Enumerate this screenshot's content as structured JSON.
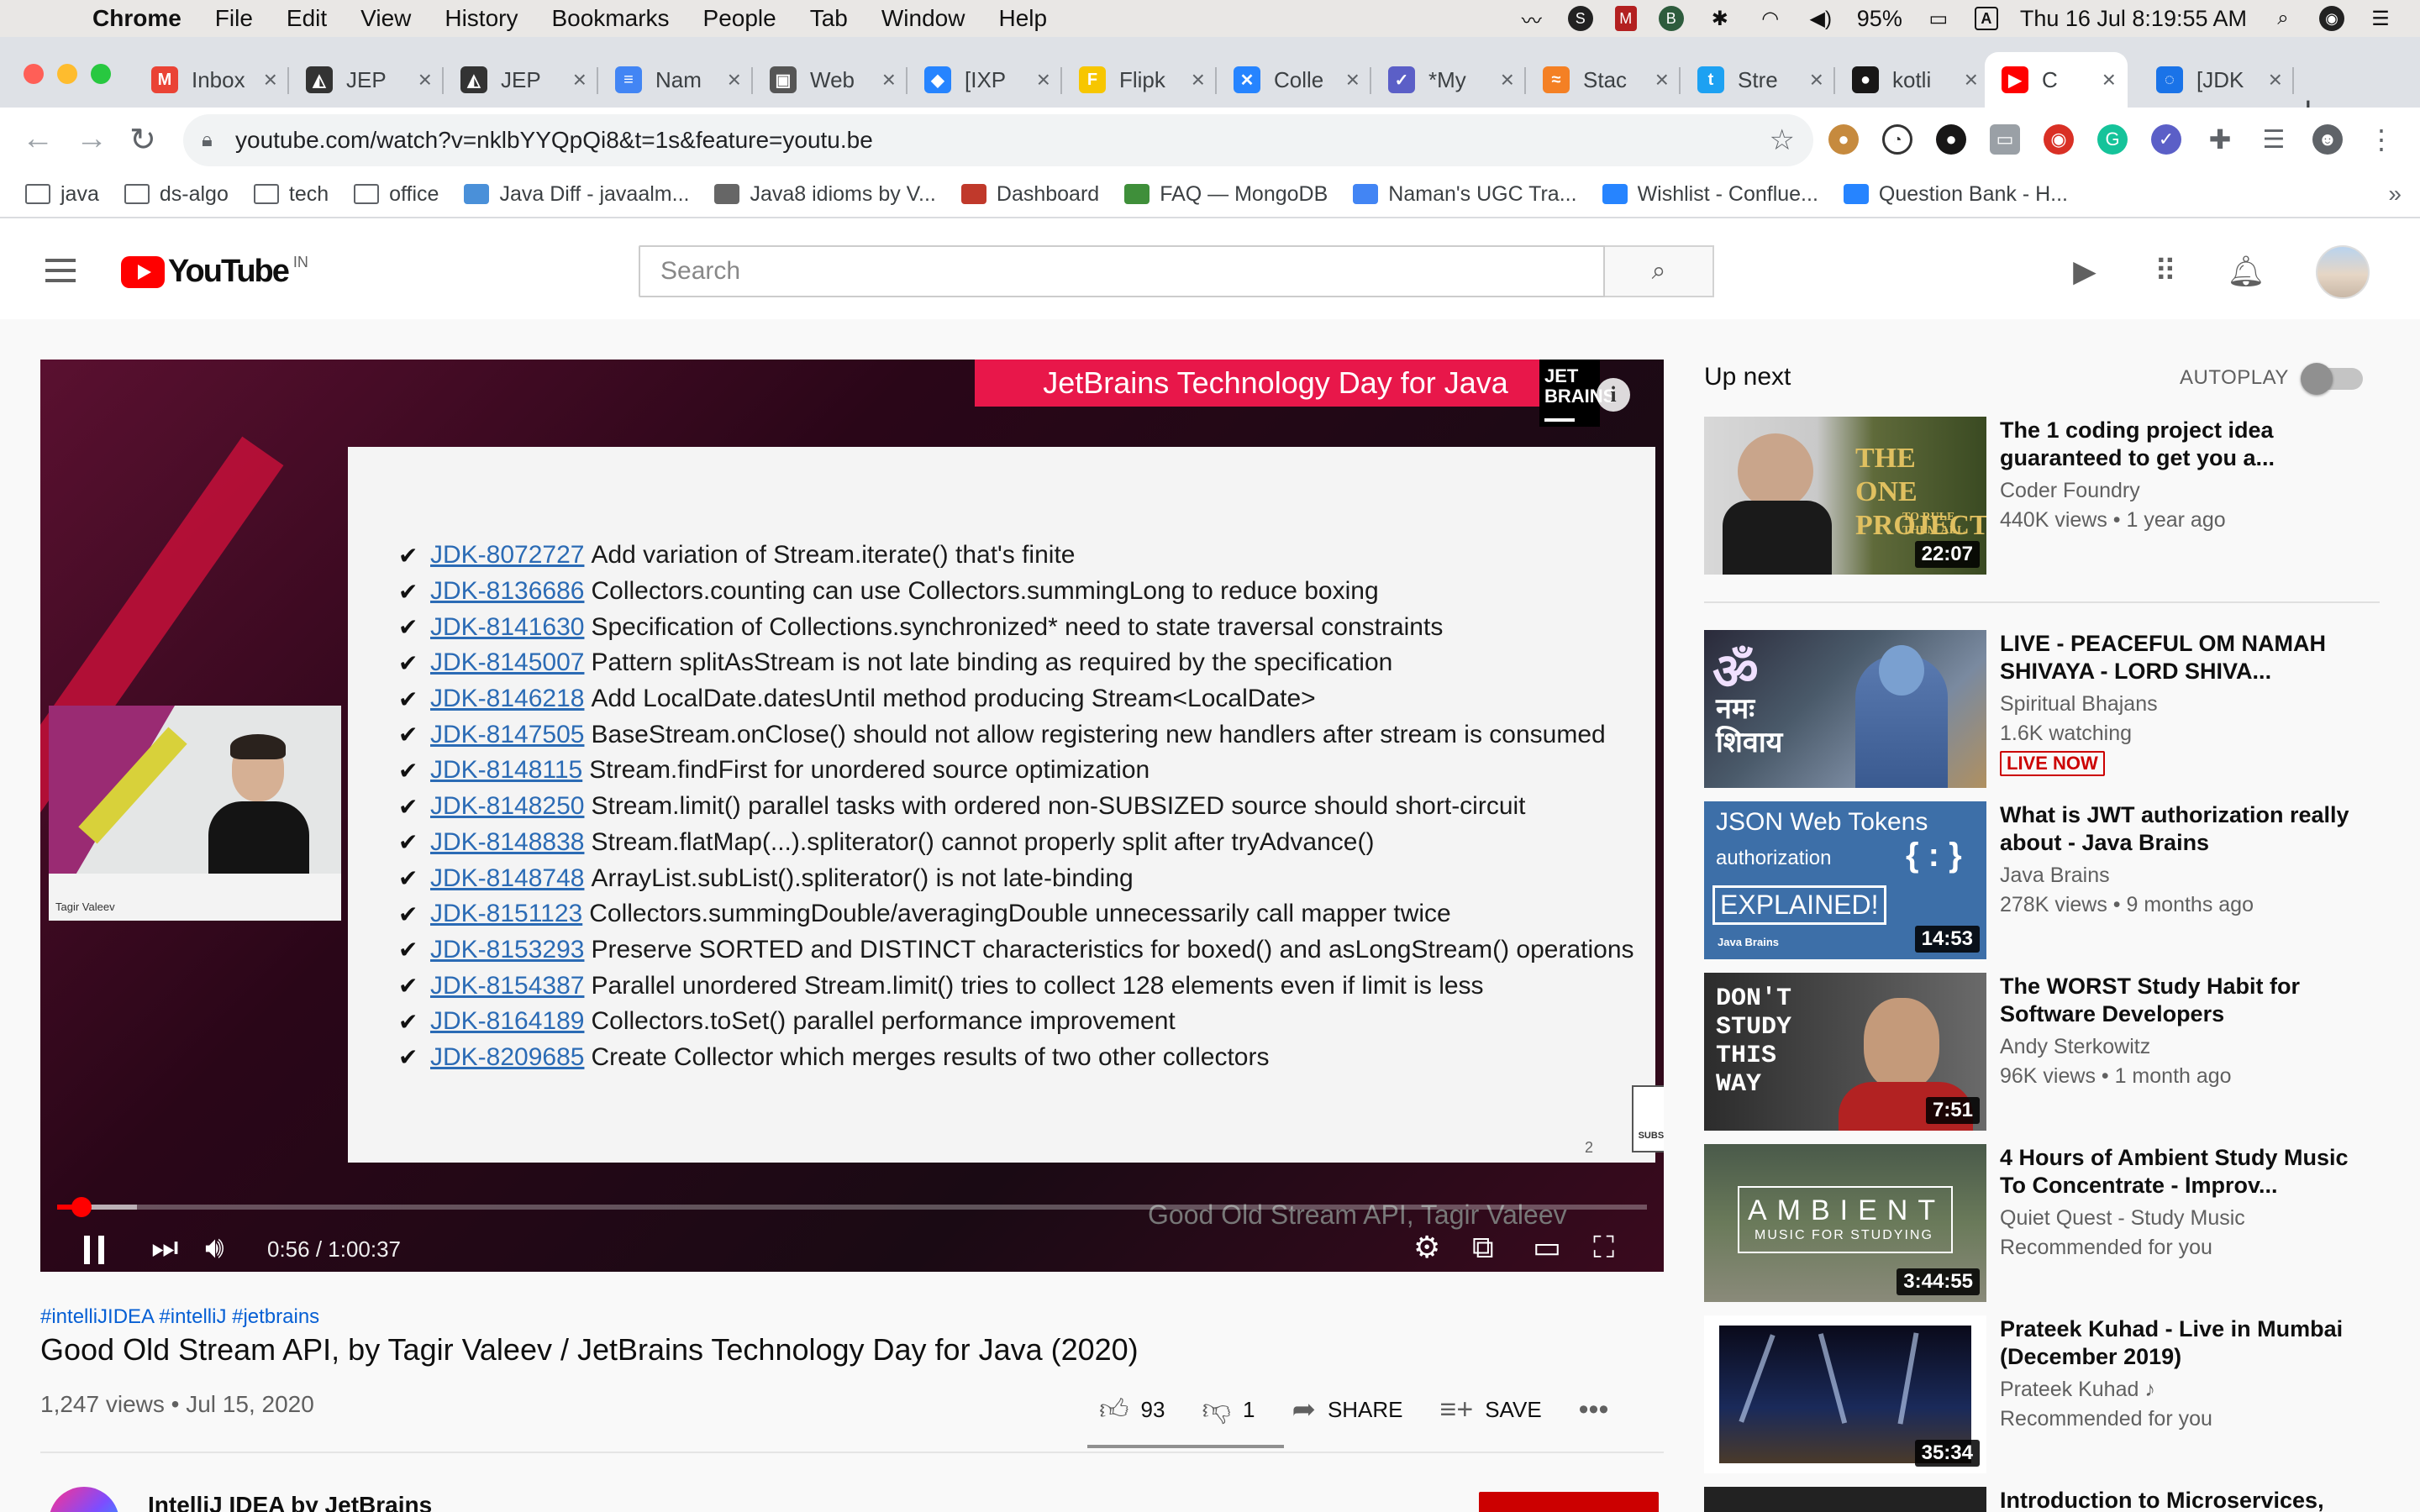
{
  "menubar": {
    "app": "Chrome",
    "items": [
      "File",
      "Edit",
      "View",
      "History",
      "Bookmarks",
      "People",
      "Tab",
      "Window",
      "Help"
    ],
    "battery": "95%",
    "datetime": "Thu 16 Jul  8:19:55 AM"
  },
  "tabs": [
    {
      "label": "Inbox",
      "icon": "gmail-icon",
      "color": "#ea4335",
      "glyph": "M"
    },
    {
      "label": "JEP",
      "icon": "jep-icon",
      "color": "#333333",
      "glyph": "◭"
    },
    {
      "label": "JEP",
      "icon": "jep-icon",
      "color": "#333333",
      "glyph": "◭"
    },
    {
      "label": "Nam",
      "icon": "docs-icon",
      "color": "#4285f4",
      "glyph": "≡"
    },
    {
      "label": "Web",
      "icon": "web-icon",
      "color": "#555555",
      "glyph": "▣"
    },
    {
      "label": "[IXP",
      "icon": "jira-icon",
      "color": "#2684ff",
      "glyph": "◆"
    },
    {
      "label": "Flipk",
      "icon": "flipkart-icon",
      "color": "#f7c600",
      "glyph": "F"
    },
    {
      "label": "Colle",
      "icon": "confluence-icon",
      "color": "#2684ff",
      "glyph": "✕"
    },
    {
      "label": "*My",
      "icon": "check-icon",
      "color": "#5b5fc7",
      "glyph": "✓"
    },
    {
      "label": "Stac",
      "icon": "stackoverflow-icon",
      "color": "#f48024",
      "glyph": "≈"
    },
    {
      "label": "Stre",
      "icon": "twitter-icon",
      "color": "#1da1f2",
      "glyph": "t"
    },
    {
      "label": "kotli",
      "icon": "github-icon",
      "color": "#181717",
      "glyph": "●"
    },
    {
      "label": "C",
      "icon": "youtube-icon",
      "color": "#ff0000",
      "glyph": "▶"
    },
    {
      "label": "[JDK",
      "icon": "loading-icon",
      "color": "#1a73e8",
      "glyph": "◌"
    }
  ],
  "toolbar": {
    "url": "youtube.com/watch?v=nklbYYQpQi8&t=1s&feature=youtu.be"
  },
  "bookmarks": [
    {
      "label": "java",
      "type": "folder"
    },
    {
      "label": "ds-algo",
      "type": "folder"
    },
    {
      "label": "tech",
      "type": "folder"
    },
    {
      "label": "office",
      "type": "folder"
    },
    {
      "label": "Java Diff - javaalm...",
      "type": "link",
      "color": "#4a90d9"
    },
    {
      "label": "Java8 idioms by V...",
      "type": "link",
      "color": "#666666"
    },
    {
      "label": "Dashboard",
      "type": "link",
      "color": "#c0392b"
    },
    {
      "label": "FAQ — MongoDB",
      "type": "link",
      "color": "#3f8f3a"
    },
    {
      "label": "Naman's UGC Tra...",
      "type": "link",
      "color": "#4285f4"
    },
    {
      "label": "Wishlist - Conflue...",
      "type": "link",
      "color": "#2684ff"
    },
    {
      "label": "Question Bank - H...",
      "type": "link",
      "color": "#2684ff"
    }
  ],
  "bookmarks_more": "»",
  "yt": {
    "logo_text": "YouTube",
    "region": "IN",
    "search_placeholder": "Search"
  },
  "player": {
    "banner": "JetBrains Technology Day for Java",
    "logo": "JET BRAINS",
    "slide_items": [
      {
        "id": "JDK-8072727",
        "text": "Add variation of Stream.iterate() that's finite"
      },
      {
        "id": "JDK-8136686",
        "text": "Collectors.counting can use Collectors.summingLong to reduce boxing"
      },
      {
        "id": "JDK-8141630",
        "text": "Specification of Collections.synchronized* need to state traversal constraints"
      },
      {
        "id": "JDK-8145007",
        "text": "Pattern splitAsStream is not late binding as required by the specification"
      },
      {
        "id": "JDK-8146218",
        "text": "Add LocalDate.datesUntil method producing Stream<LocalDate>"
      },
      {
        "id": "JDK-8147505",
        "text": "BaseStream.onClose() should not allow registering new handlers after stream is consumed"
      },
      {
        "id": "JDK-8148115",
        "text": "Stream.findFirst for unordered source optimization"
      },
      {
        "id": "JDK-8148250",
        "text": "Stream.limit() parallel tasks with ordered non-SUBSIZED source should short-circuit"
      },
      {
        "id": "JDK-8148838",
        "text": "Stream.flatMap(...).spliterator() cannot properly split after tryAdvance()"
      },
      {
        "id": "JDK-8148748",
        "text": "ArrayList.subList().spliterator() is not late-binding"
      },
      {
        "id": "JDK-8151123",
        "text": "Collectors.summingDouble/averagingDouble unnecessarily call mapper twice"
      },
      {
        "id": "JDK-8153293",
        "text": "Preserve SORTED and DISTINCT characteristics for boxed() and asLongStream() operations"
      },
      {
        "id": "JDK-8154387",
        "text": "Parallel unordered Stream.limit() tries to collect 128 elements even if limit is less"
      },
      {
        "id": "JDK-8164189",
        "text": "Collectors.toSet() parallel performance improvement"
      },
      {
        "id": "JDK-8209685",
        "text": "Create Collector which merges results of two other collectors"
      }
    ],
    "slide_number": "2",
    "subscribe": "SUBSCRIBE",
    "speaker_name": "Tagir Valeev",
    "subtitle_overlay": "Good Old Stream API, Tagir Valeev",
    "time": "0:56 / 1:00:37",
    "progress_fraction": 0.0154
  },
  "video": {
    "hashtags": "#intelliJIDEA #intelliJ #jetbrains",
    "title": "Good Old Stream API, by Tagir Valeev / JetBrains Technology Day for Java (2020)",
    "meta": "1,247 views • Jul 15, 2020",
    "likes": "93",
    "dislikes": "1",
    "share": "SHARE",
    "save": "SAVE",
    "channel": "IntelliJ IDEA by JetBrains"
  },
  "sidebar": {
    "up_next": "Up next",
    "autoplay": "AUTOPLAY",
    "cards": [
      {
        "title": "The 1 coding project idea guaranteed to get you a...",
        "channel": "Coder Foundry",
        "stats": "440K views • 1 year ago",
        "duration": "22:07",
        "thumb_text": "THE ONE PROJECT",
        "thumb_sub": "TO RULE THEM ALL"
      },
      {
        "title": "LIVE - PEACEFUL OM NAMAH SHIVAYA - LORD SHIVA...",
        "channel": "Spiritual Bhajans",
        "stats": "1.6K watching",
        "badge": "LIVE NOW",
        "thumb_text": "नमः शिवाय",
        "thumb_sub": "ॐ"
      },
      {
        "title": "What is JWT authorization really about - Java Brains",
        "channel": "Java Brains",
        "stats": "278K views • 9 months ago",
        "duration": "14:53",
        "thumb_text": "JSON Web Tokens",
        "thumb_sub": "authorization",
        "thumb_box": "EXPLAINED!",
        "thumb_brace": "{ : }",
        "thumb_brand": "Java Brains"
      },
      {
        "title": "The WORST Study Habit for Software Developers",
        "channel": "Andy Sterkowitz",
        "stats": "96K views • 1 month ago",
        "duration": "7:51",
        "thumb_text": "DON'T STUDY THIS WAY"
      },
      {
        "title": "4 Hours of Ambient Study Music To Concentrate - Improv...",
        "channel": "Quiet Quest - Study Music",
        "stats": "Recommended for you",
        "duration": "3:44:55",
        "thumb_text": "AMBIENT",
        "thumb_sub": "MUSIC FOR STUDYING"
      },
      {
        "title": "Prateek Kuhad - Live in Mumbai (December 2019)",
        "channel": "Prateek Kuhad ♪",
        "stats": "Recommended for you",
        "duration": "35:34"
      },
      {
        "title": "Introduction to Microservices,",
        "channel": "",
        "stats": ""
      }
    ]
  }
}
